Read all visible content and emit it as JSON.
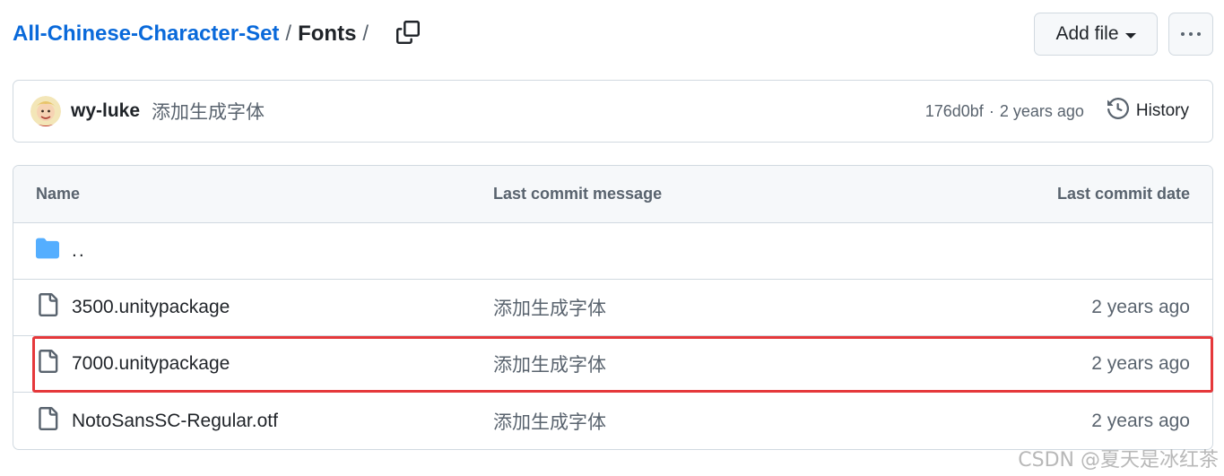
{
  "breadcrumb": {
    "repo": "All-Chinese-Character-Set",
    "separator": "/",
    "current": "Fonts",
    "trailing_separator": "/"
  },
  "actions": {
    "add_file_label": "Add file",
    "more_icon": "kebab-horizontal-icon",
    "copy_icon": "copy-icon"
  },
  "latest_commit": {
    "author": "wy-luke",
    "message": "添加生成字体",
    "sha": "176d0bf",
    "dot": "·",
    "time": "2 years ago",
    "history_label": "History"
  },
  "table": {
    "headers": {
      "name": "Name",
      "message": "Last commit message",
      "date": "Last commit date"
    },
    "parent_dir": "..",
    "rows": [
      {
        "icon": "file-icon",
        "name": "3500.unitypackage",
        "message": "添加生成字体",
        "date": "2 years ago"
      },
      {
        "icon": "file-icon",
        "name": "7000.unitypackage",
        "message": "添加生成字体",
        "date": "2 years ago"
      },
      {
        "icon": "file-icon",
        "name": "NotoSansSC-Regular.otf",
        "message": "添加生成字体",
        "date": "2 years ago"
      }
    ]
  },
  "colors": {
    "link": "#0969da",
    "folder": "#54aeff",
    "highlight": "#e5383b",
    "muted": "#59636e"
  },
  "watermark": "CSDN @夏天是冰红茶"
}
